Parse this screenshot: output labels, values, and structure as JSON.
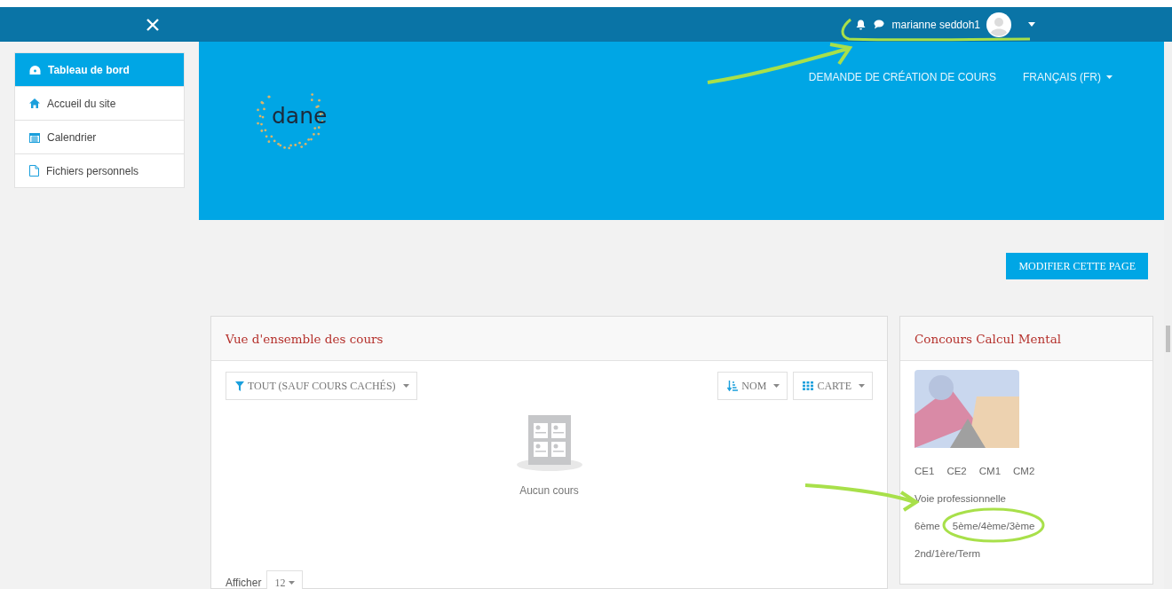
{
  "navbar": {
    "user_name": "marianne seddoh1"
  },
  "sidebar": {
    "items": [
      {
        "label": "Tableau de bord",
        "selected": true
      },
      {
        "label": "Accueil du site",
        "selected": false
      },
      {
        "label": "Calendrier",
        "selected": false
      },
      {
        "label": "Fichiers personnels",
        "selected": false
      }
    ]
  },
  "header": {
    "logo_text": "dane",
    "links": [
      {
        "label": "DEMANDE DE CRÉATION DE COURS",
        "dropdown": false
      },
      {
        "label": "FRANÇAIS (FR)",
        "dropdown": true
      }
    ]
  },
  "edit_button": "MODIFIER CETTE PAGE",
  "course_overview": {
    "title": "Vue d'ensemble des cours",
    "filter": "TOUT (SAUF COURS CACHÉS)",
    "sort": "NOM",
    "view": "CARTE",
    "empty_text": "Aucun cours",
    "show_label": "Afficher",
    "show_count": "12"
  },
  "side_block": {
    "title": "Concours Calcul Mental",
    "category_rows": [
      {
        "links": [
          "CE1",
          "CE2",
          "CM1",
          "CM2"
        ]
      },
      {
        "links": [
          "Voie professionnelle"
        ]
      },
      {
        "links": [
          "6ème",
          "5ème/4ème/3ème"
        ]
      },
      {
        "links": [
          "2nd/1ère/Term"
        ]
      }
    ]
  }
}
